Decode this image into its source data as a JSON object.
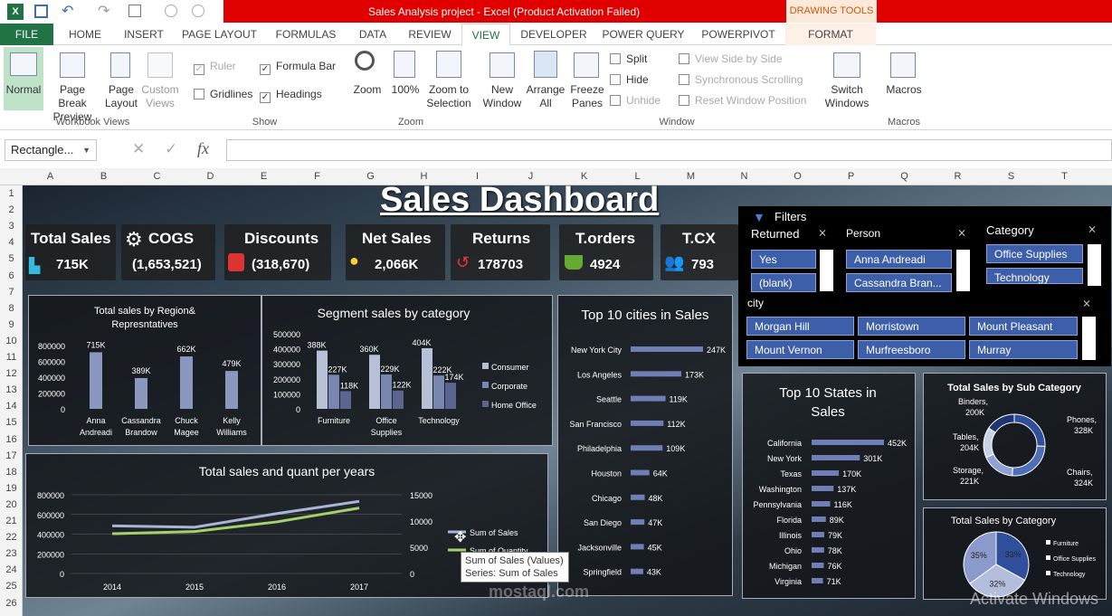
{
  "window": {
    "title": "Sales Analysis project - Excel (Product Activation Failed)",
    "context": "DRAWING TOOLS"
  },
  "tabs": [
    "FILE",
    "HOME",
    "INSERT",
    "PAGE LAYOUT",
    "FORMULAS",
    "DATA",
    "REVIEW",
    "VIEW",
    "DEVELOPER",
    "POWER QUERY",
    "POWERPIVOT",
    "FORMAT"
  ],
  "ribbon": {
    "workbook_views": {
      "group": "Workbook Views",
      "normal": "Normal",
      "page_break": "Page Break Preview",
      "page_layout": "Page Layout",
      "custom_views": "Custom Views"
    },
    "show": {
      "group": "Show",
      "ruler": "Ruler",
      "formula_bar": "Formula Bar",
      "gridlines": "Gridlines",
      "headings": "Headings"
    },
    "zoom": {
      "group": "Zoom",
      "zoom": "Zoom",
      "zoom100": "100%",
      "zoom_sel": "Zoom to Selection"
    },
    "window": {
      "group": "Window",
      "new": "New Window",
      "arrange": "Arrange All",
      "freeze": "Freeze Panes",
      "split": "Split",
      "hide": "Hide",
      "unhide": "Unhide",
      "side": "View Side by Side",
      "sync": "Synchronous Scrolling",
      "reset": "Reset Window Position",
      "switch": "Switch Windows"
    },
    "macros": {
      "group": "Macros",
      "macros": "Macros"
    }
  },
  "formula_bar": {
    "name_box": "Rectangle...",
    "fx": "fx",
    "value": ""
  },
  "columns": [
    "A",
    "B",
    "C",
    "D",
    "E",
    "F",
    "G",
    "H",
    "I",
    "J",
    "K",
    "L",
    "M",
    "N",
    "O",
    "P",
    "Q",
    "R",
    "S",
    "T"
  ],
  "rows": [
    "1",
    "2",
    "3",
    "4",
    "5",
    "6",
    "7",
    "8",
    "9",
    "10",
    "11",
    "12",
    "13",
    "14",
    "15",
    "16",
    "17",
    "18",
    "19",
    "20",
    "21",
    "22",
    "23",
    "24",
    "25",
    "26"
  ],
  "dashboard": {
    "title": "Sales Dashboard",
    "kpis": [
      {
        "label": "Total Sales",
        "value": "715K"
      },
      {
        "label": "COGS",
        "value": "(1,653,521)"
      },
      {
        "label": "Discounts",
        "value": "(318,670)"
      },
      {
        "label": "Net Sales",
        "value": "2,066K"
      },
      {
        "label": "Returns",
        "value": "178703"
      },
      {
        "label": "T.orders",
        "value": "4924"
      },
      {
        "label": "T.CX",
        "value": "793"
      }
    ],
    "filters": {
      "title": "Filters",
      "returned": {
        "label": "Returned",
        "items": [
          "Yes",
          "(blank)"
        ]
      },
      "person": {
        "label": "Person",
        "items": [
          "Anna Andreadi",
          "Cassandra Bran..."
        ]
      },
      "category": {
        "label": "Category",
        "items": [
          "Office Supplies",
          "Technology"
        ]
      },
      "city": {
        "label": "city",
        "items": [
          "Morgan Hill",
          "Morristown",
          "Mount Pleasant",
          "Mount Vernon",
          "Murfreesboro",
          "Murray"
        ]
      }
    },
    "tooltip": {
      "line1": "Sum of Sales (Values)",
      "line2": "Series: Sum of Sales"
    },
    "watermark": "Activate Windows",
    "logo": "mostaql.com"
  },
  "chart_data": [
    {
      "id": "region",
      "type": "bar",
      "title": "Total sales by Region& Represntatives",
      "categories": [
        "Anna Andreadi",
        "Cassandra Brandow",
        "Chuck Magee",
        "Kelly Williams"
      ],
      "values": [
        715000,
        389000,
        662000,
        479000
      ],
      "labels": [
        "715K",
        "389K",
        "662K",
        "479K"
      ],
      "ylim": [
        0,
        800000
      ],
      "yticks": [
        "800000",
        "600000",
        "400000",
        "200000",
        "0"
      ]
    },
    {
      "id": "segment",
      "type": "bar",
      "title": "Segment sales by category",
      "categories": [
        "Furniture",
        "Office Supplies",
        "Technology"
      ],
      "series": [
        {
          "name": "Consumer",
          "values": [
            388000,
            360000,
            404000
          ],
          "labels": [
            "388K",
            "360K",
            "404K"
          ]
        },
        {
          "name": "Corporate",
          "values": [
            227000,
            229000,
            222000
          ],
          "labels": [
            "227K",
            "229K",
            "222K"
          ]
        },
        {
          "name": "Home Office",
          "values": [
            118000,
            122000,
            174000
          ],
          "labels": [
            "118K",
            "122K",
            "174K"
          ]
        }
      ],
      "ylim": [
        0,
        500000
      ],
      "yticks": [
        "500000",
        "400000",
        "300000",
        "200000",
        "100000",
        "0"
      ],
      "legend": "right"
    },
    {
      "id": "cities",
      "type": "bar",
      "orientation": "horizontal",
      "title": "Top 10 cities in Sales",
      "categories": [
        "New York City",
        "Los Angeles",
        "Seattle",
        "San Francisco",
        "Philadelphia",
        "Houston",
        "Chicago",
        "San Diego",
        "Jacksonville",
        "Springfield"
      ],
      "values": [
        247000,
        173000,
        119000,
        112000,
        109000,
        64000,
        48000,
        47000,
        45000,
        43000
      ],
      "labels": [
        "247K",
        "173K",
        "119K",
        "112K",
        "109K",
        "64K",
        "48K",
        "47K",
        "45K",
        "43K"
      ]
    },
    {
      "id": "states",
      "type": "bar",
      "orientation": "horizontal",
      "title": "Top 10 States in Sales",
      "categories": [
        "California",
        "New York",
        "Texas",
        "Washington",
        "Pennsylvania",
        "Florida",
        "Illinois",
        "Ohio",
        "Michigan",
        "Virginia"
      ],
      "values": [
        452000,
        301000,
        170000,
        137000,
        116000,
        89000,
        79000,
        78000,
        76000,
        71000
      ],
      "labels": [
        "452K",
        "301K",
        "170K",
        "137K",
        "116K",
        "89K",
        "79K",
        "78K",
        "76K",
        "71K"
      ]
    },
    {
      "id": "years",
      "type": "line",
      "title": "Total sales and quant per years",
      "categories": [
        "2014",
        "2015",
        "2016",
        "2017"
      ],
      "series": [
        {
          "name": "Sum of Sales",
          "values": [
            484000,
            470000,
            609000,
            733000
          ],
          "axis": "left"
        },
        {
          "name": "Sum of Quantity",
          "values": [
            7581,
            8000,
            9837,
            12476
          ],
          "axis": "right"
        }
      ],
      "ylim": [
        0,
        800000
      ],
      "y2lim": [
        0,
        15000
      ],
      "yticks": [
        "800000",
        "600000",
        "400000",
        "200000",
        "0"
      ],
      "y2ticks": [
        "15000",
        "10000",
        "5000",
        "0"
      ]
    },
    {
      "id": "subcat",
      "type": "pie",
      "donut": true,
      "title": "Total Sales by Sub Category",
      "slices": [
        {
          "label": "Phones, 328K",
          "value": 328000
        },
        {
          "label": "Chairs, 324K",
          "value": 324000
        },
        {
          "label": "Storage, 221K",
          "value": 221000
        },
        {
          "label": "Tables, 204K",
          "value": 204000
        },
        {
          "label": "Binders, 200K",
          "value": 200000
        }
      ]
    },
    {
      "id": "category",
      "type": "pie",
      "title": "Total Sales by Category",
      "slices": [
        {
          "label": "Furniture",
          "value": 35,
          "text": "35%"
        },
        {
          "label": "Office Supplies",
          "value": 32,
          "text": "32%"
        },
        {
          "label": "Technology",
          "value": 33,
          "text": "33%"
        }
      ],
      "legend": "right"
    }
  ]
}
